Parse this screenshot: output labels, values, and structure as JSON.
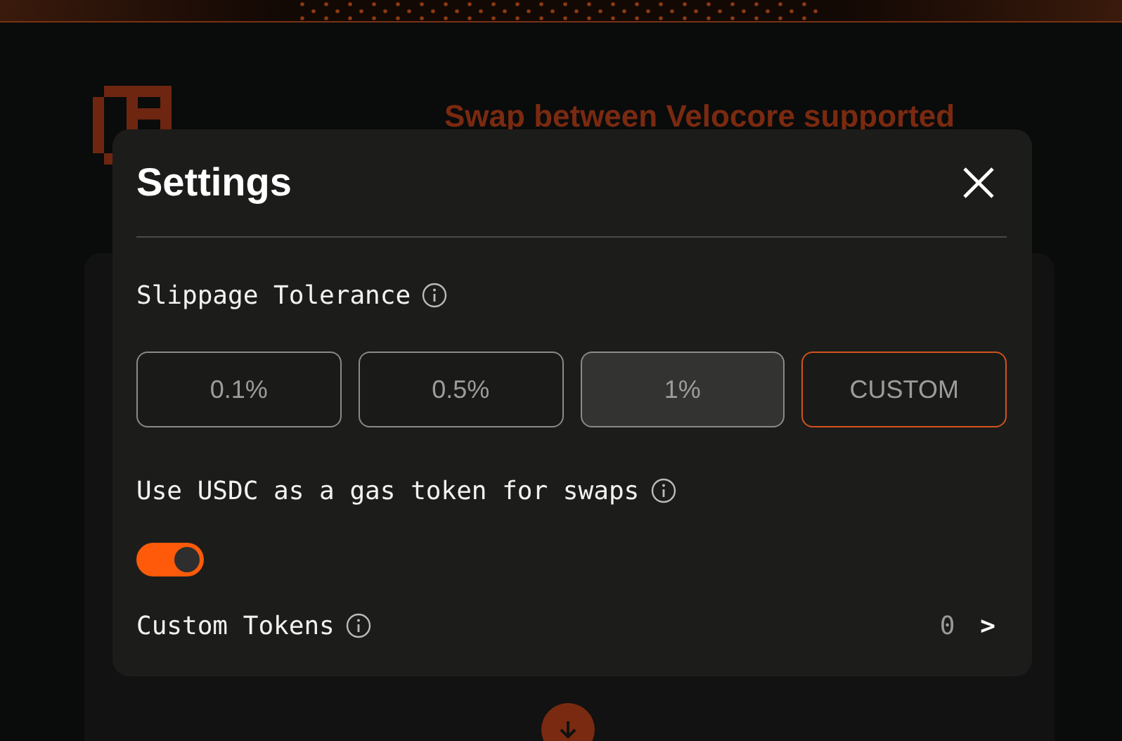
{
  "page": {
    "subtitle": "Swap between Velocore supported"
  },
  "settings": {
    "title": "Settings",
    "slippage": {
      "label": "Slippage Tolerance",
      "options": [
        {
          "label": "0.1%",
          "kind": "preset",
          "selected": false
        },
        {
          "label": "0.5%",
          "kind": "preset",
          "selected": false
        },
        {
          "label": "1%",
          "kind": "preset",
          "selected": true
        },
        {
          "label": "CUSTOM",
          "kind": "custom",
          "selected": false
        }
      ]
    },
    "gas_token": {
      "label": "Use USDC as a gas token for swaps",
      "on": true
    },
    "custom_tokens": {
      "label": "Custom Tokens",
      "count": "0",
      "chevron": ">"
    }
  }
}
